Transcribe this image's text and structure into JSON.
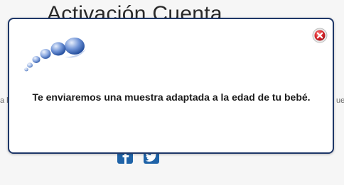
{
  "background": {
    "title": "Activación Cuenta",
    "edge_left_text": "a l",
    "edge_right_text": "ue"
  },
  "social": {
    "facebook_icon": "facebook-icon",
    "twitter_icon": "twitter-icon"
  },
  "modal": {
    "logo_icon": "brand-dots-logo",
    "close_icon": "close-icon",
    "message": "Te enviaremos una muestra adaptada a la edad de tu bebé."
  },
  "colors": {
    "modal_border": "#1e3768",
    "close_red": "#d9262c",
    "social_blue": "#1f63a8",
    "logo_blue": "#2f5fb1"
  }
}
